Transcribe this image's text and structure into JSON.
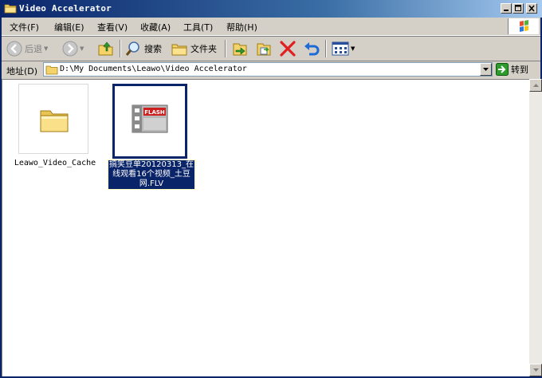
{
  "window": {
    "title": "Video Accelerator"
  },
  "menu": {
    "items": [
      "文件(F)",
      "编辑(E)",
      "查看(V)",
      "收藏(A)",
      "工具(T)",
      "帮助(H)"
    ]
  },
  "toolbar": {
    "back_label": "后退",
    "search_label": "搜索",
    "folders_label": "文件夹"
  },
  "address": {
    "label": "地址(D)",
    "path": "D:\\My Documents\\Leawo\\Video Accelerator",
    "go_label": "转到"
  },
  "files": [
    {
      "name": "Leawo_Video_Cache",
      "type": "folder",
      "selected": false
    },
    {
      "name": "搞笑豆单20120313_在线观看16个视频_土豆网.FLV",
      "type": "flv",
      "selected": true
    }
  ],
  "icons": {
    "title": "folder-icon",
    "back": "back-arrow-icon",
    "forward": "forward-arrow-icon",
    "up": "up-folder-icon",
    "search": "search-icon",
    "folders": "folders-icon",
    "move": "move-to-icon",
    "copy": "copy-to-icon",
    "delete": "delete-icon",
    "undo": "undo-icon",
    "views": "views-icon",
    "go": "go-arrow-icon",
    "flv": "flash-video-icon"
  },
  "colors": {
    "title_bar": "#0a246a",
    "face": "#d4d0c8",
    "selection": "#0a246a",
    "delete": "#e02020"
  }
}
